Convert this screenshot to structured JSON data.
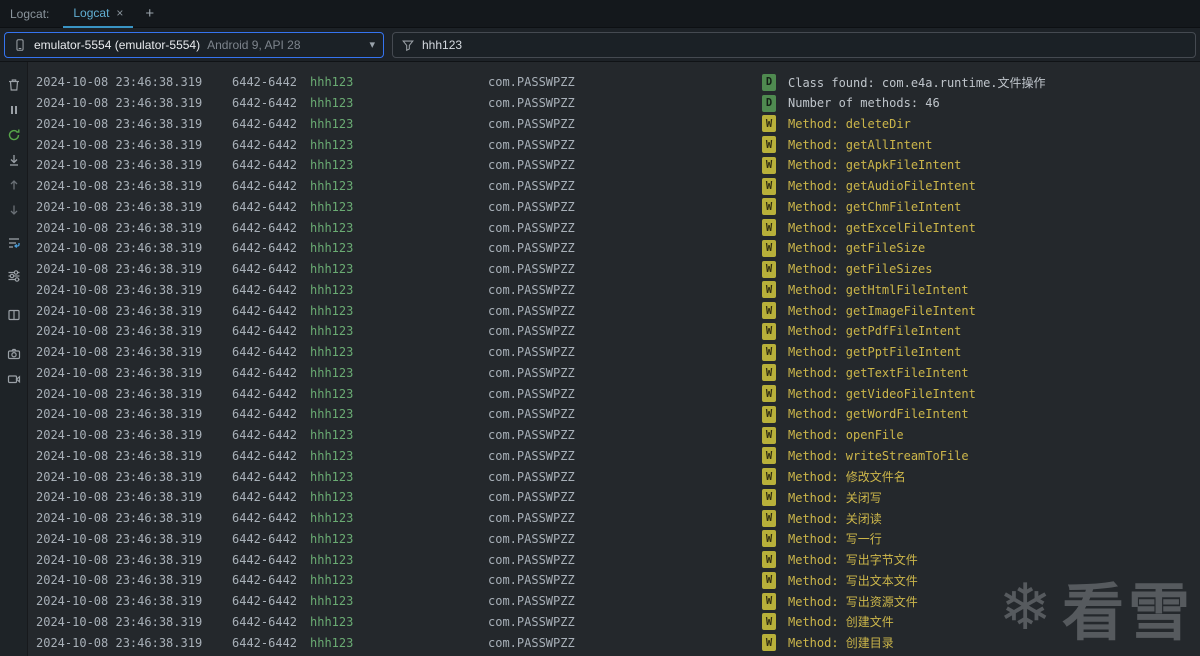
{
  "title_bar": {
    "window_label": "Logcat:",
    "tab_label": "Logcat",
    "tab_close": "×",
    "new_tab": "+"
  },
  "toolbar": {
    "device": {
      "name": "emulator-5554 (emulator-5554)",
      "details": "Android 9, API 28",
      "chevron": "▾"
    },
    "filter_value": "hhh123"
  },
  "side_toolbar": {
    "icons": [
      "clear-logcat",
      "pause-logcat",
      "restart-logcat",
      "scroll-to-end",
      "previous-occurrence",
      "next-occurrence",
      "soft-wrap",
      "configure-logcat",
      "split-panels",
      "take-screenshot",
      "record-screen"
    ]
  },
  "log": {
    "repeated": {
      "timestamp": "2024-10-08 23:46:38.319",
      "pid_tid": "6442-6442",
      "tag": "hhh123",
      "package": "com.PASSWPZZ"
    },
    "messages": [
      {
        "level": "D",
        "text": "Class found: com.e4a.runtime.文件操作"
      },
      {
        "level": "D",
        "text": "Number of methods: 46"
      },
      {
        "level": "W",
        "text": "Method: deleteDir"
      },
      {
        "level": "W",
        "text": "Method: getAllIntent"
      },
      {
        "level": "W",
        "text": "Method: getApkFileIntent"
      },
      {
        "level": "W",
        "text": "Method: getAudioFileIntent"
      },
      {
        "level": "W",
        "text": "Method: getChmFileIntent"
      },
      {
        "level": "W",
        "text": "Method: getExcelFileIntent"
      },
      {
        "level": "W",
        "text": "Method: getFileSize"
      },
      {
        "level": "W",
        "text": "Method: getFileSizes"
      },
      {
        "level": "W",
        "text": "Method: getHtmlFileIntent"
      },
      {
        "level": "W",
        "text": "Method: getImageFileIntent"
      },
      {
        "level": "W",
        "text": "Method: getPdfFileIntent"
      },
      {
        "level": "W",
        "text": "Method: getPptFileIntent"
      },
      {
        "level": "W",
        "text": "Method: getTextFileIntent"
      },
      {
        "level": "W",
        "text": "Method: getVideoFileIntent"
      },
      {
        "level": "W",
        "text": "Method: getWordFileIntent"
      },
      {
        "level": "W",
        "text": "Method: openFile"
      },
      {
        "level": "W",
        "text": "Method: writeStreamToFile"
      },
      {
        "level": "W",
        "text": "Method: 修改文件名"
      },
      {
        "level": "W",
        "text": "Method: 关闭写"
      },
      {
        "level": "W",
        "text": "Method: 关闭读"
      },
      {
        "level": "W",
        "text": "Method: 写一行"
      },
      {
        "level": "W",
        "text": "Method: 写出字节文件"
      },
      {
        "level": "W",
        "text": "Method: 写出文本文件"
      },
      {
        "level": "W",
        "text": "Method: 写出资源文件"
      },
      {
        "level": "W",
        "text": "Method: 创建文件"
      },
      {
        "level": "W",
        "text": "Method: 创建目录"
      }
    ]
  },
  "watermark": {
    "snowflake": "❄",
    "text": "看雪"
  },
  "colors": {
    "accent": "#3574f0",
    "tab_underline": "#3994c4",
    "tag_green": "#6aab73",
    "warning_text": "#ccb64a",
    "warning_badge_bg": "#b8b03a",
    "debug_badge_bg": "#4f8a50"
  }
}
